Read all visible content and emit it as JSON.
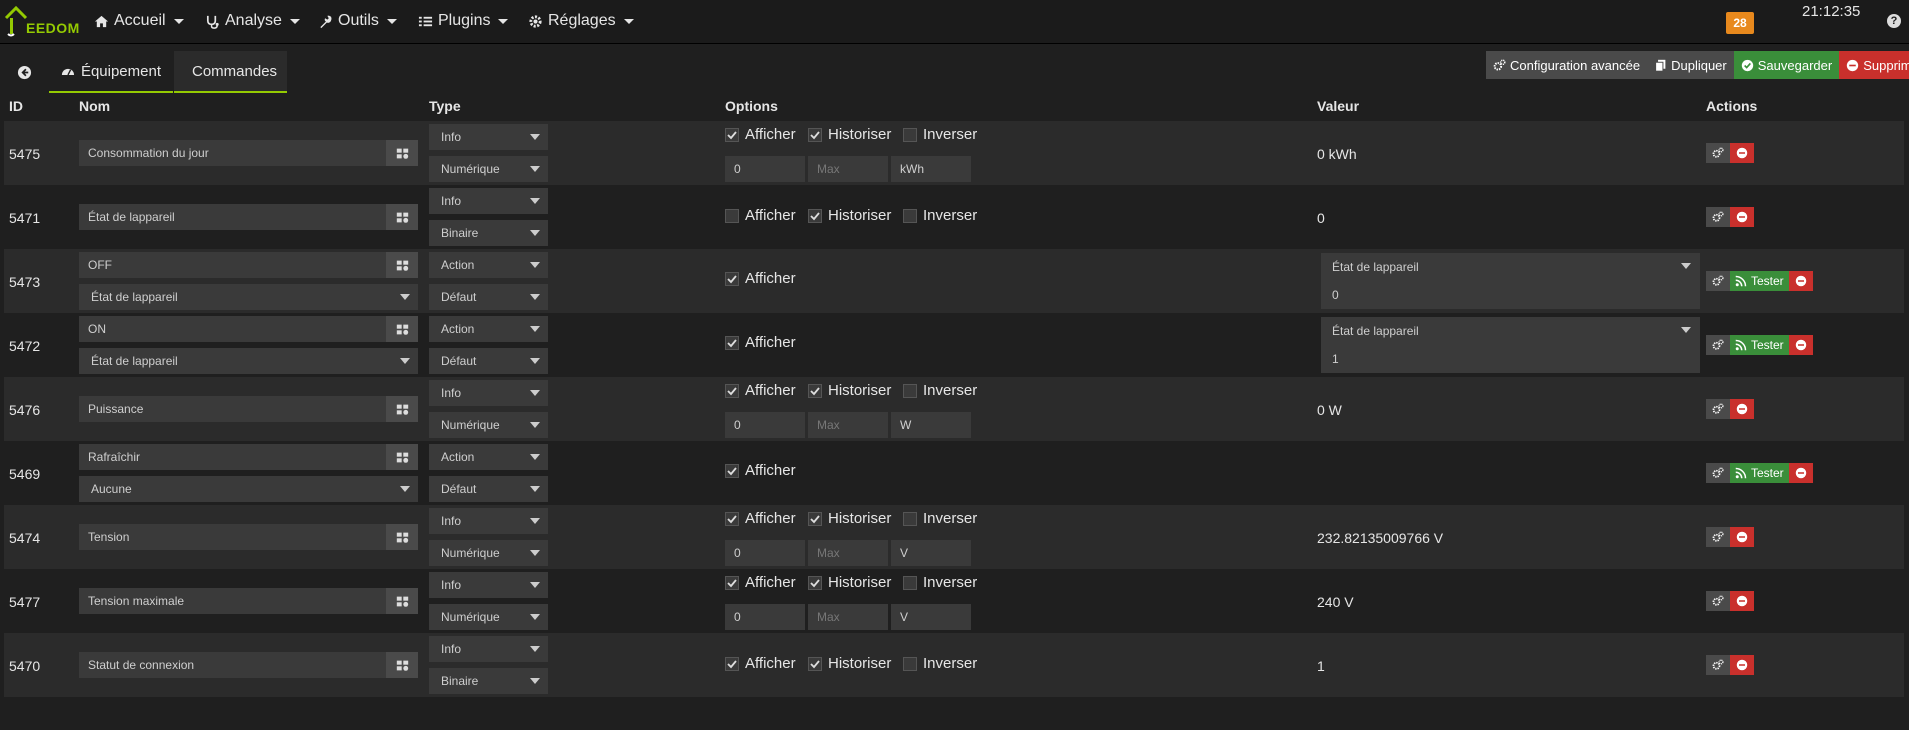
{
  "navbar": {
    "brand": "EEDOM",
    "menus": [
      {
        "label": "Accueil",
        "icon": "home-icon"
      },
      {
        "label": "Analyse",
        "icon": "stethoscope-icon"
      },
      {
        "label": "Outils",
        "icon": "wrench-icon"
      },
      {
        "label": "Plugins",
        "icon": "tasks-icon"
      },
      {
        "label": "Réglages",
        "icon": "cogs-icon"
      }
    ],
    "badge_count": "28",
    "time": "21:12:35",
    "help": "?"
  },
  "tabs": {
    "equipment": "Équipement",
    "commands": "Commandes"
  },
  "toolbar": {
    "config": "Configuration avancée",
    "duplicate": "Dupliquer",
    "save": "Sauvegarder",
    "delete": "Supprimer"
  },
  "table": {
    "headers": {
      "id": "ID",
      "name": "Nom",
      "type": "Type",
      "options": "Options",
      "value": "Valeur",
      "actions": "Actions"
    },
    "labels": {
      "afficher": "Afficher",
      "historiser": "Historiser",
      "inverser": "Inverser",
      "tester": "Tester",
      "max_placeholder": "Max"
    },
    "rows": [
      {
        "id": "5475",
        "name": "Consommation du jour",
        "type": "Info",
        "subtype": "Numérique",
        "afficher": true,
        "historiser": true,
        "inverser": false,
        "min": "0",
        "unit": "kWh",
        "value": "0 kWh"
      },
      {
        "id": "5471",
        "name": "État de lappareil",
        "type": "Info",
        "subtype": "Binaire",
        "afficher": false,
        "historiser": true,
        "inverser": false,
        "value": "0"
      },
      {
        "id": "5473",
        "name": "OFF",
        "linked": "État de lappareil",
        "type": "Action",
        "subtype": "Défaut",
        "afficher": true,
        "info_cmd": "État de lappareil",
        "info_value": "0"
      },
      {
        "id": "5472",
        "name": "ON",
        "linked": "État de lappareil",
        "type": "Action",
        "subtype": "Défaut",
        "afficher": true,
        "info_cmd": "État de lappareil",
        "info_value": "1"
      },
      {
        "id": "5476",
        "name": "Puissance",
        "type": "Info",
        "subtype": "Numérique",
        "afficher": true,
        "historiser": true,
        "inverser": false,
        "min": "0",
        "unit": "W",
        "value": "0 W"
      },
      {
        "id": "5469",
        "name": "Rafraîchir",
        "linked": "Aucune",
        "type": "Action",
        "subtype": "Défaut",
        "afficher": true
      },
      {
        "id": "5474",
        "name": "Tension",
        "type": "Info",
        "subtype": "Numérique",
        "afficher": true,
        "historiser": true,
        "inverser": false,
        "min": "0",
        "unit": "V",
        "value": "232.82135009766 V"
      },
      {
        "id": "5477",
        "name": "Tension maximale",
        "type": "Info",
        "subtype": "Numérique",
        "afficher": true,
        "historiser": true,
        "inverser": false,
        "min": "0",
        "unit": "V",
        "value": "240 V"
      },
      {
        "id": "5470",
        "name": "Statut de connexion",
        "type": "Info",
        "subtype": "Binaire",
        "afficher": true,
        "historiser": true,
        "inverser": false,
        "value": "1"
      }
    ]
  },
  "colors": {
    "accent": "#94ca02",
    "green": "#3a8e3a",
    "red": "#c9302c",
    "badge": "#e8891d"
  }
}
